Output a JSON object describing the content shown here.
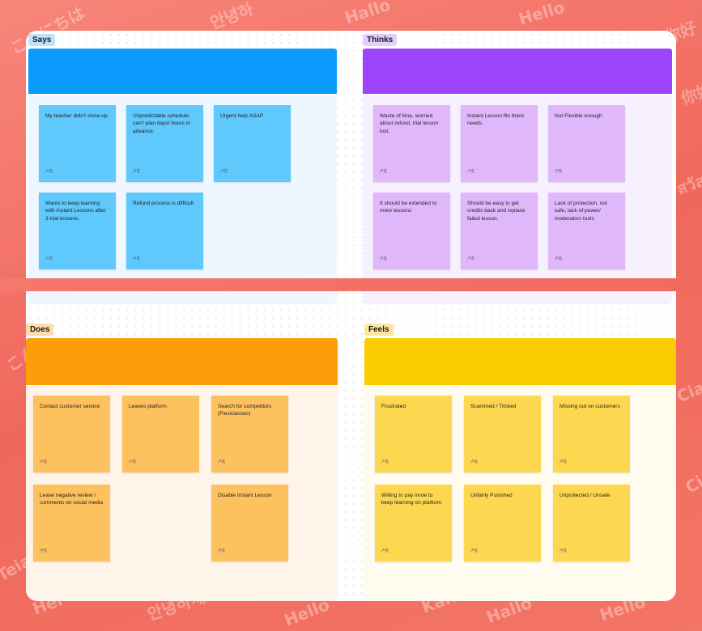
{
  "watermarks": [
    "こんにちは",
    "안녕하",
    "Hallo",
    "Hello",
    "你好",
    "Ciao",
    "안녕하세요",
    "Hello",
    "Hallo",
    "Hello",
    "Kan",
    "Teia",
    "Hei",
    "สวัสดี",
    "你好",
    "Ciao",
    "こんにちは",
    "안녕하세요",
    "Hello",
    "にちは"
  ],
  "quadrants": {
    "says": {
      "label": "Says",
      "banner_color": "#0a9bfd",
      "panel_color": "#eef7ff",
      "tag_color": "#bde3fd",
      "note_color": "#5fc8fc",
      "notes": [
        {
          "text": "My teacher didn't show up.",
          "author": "卢克"
        },
        {
          "text": "Unpredictable schedule, can't plan days/ hours in advance.",
          "author": "卢克"
        },
        {
          "text": "Urgent help ASAP",
          "author": "卢克"
        },
        {
          "text": "Wants to keep learning with Instant Lessons after 3 trial lessons.",
          "author": "卢克"
        },
        {
          "text": "Refund process is difficult",
          "author": "卢克"
        }
      ]
    },
    "thinks": {
      "label": "Thinks",
      "banner_color": "#9c44fc",
      "panel_color": "#f6f0ff",
      "tag_color": "#e2cdfc",
      "note_color": "#e0b7fb",
      "notes": [
        {
          "text": "Waste of time, worried about refund, trial lesson lost.",
          "author": "卢克"
        },
        {
          "text": "Instant Lesson fits there needs.",
          "author": "卢克"
        },
        {
          "text": "Not Flexible enough",
          "author": "卢克"
        },
        {
          "text": "It should be extended to more lessons",
          "author": "卢克"
        },
        {
          "text": "Should be easy to get credits back and replace failed lesson.",
          "author": "卢克"
        },
        {
          "text": "Lack of protection, not safe, lack of power/ moderation tools",
          "author": "卢克"
        }
      ]
    },
    "does": {
      "label": "Does",
      "banner_color": "#fd9d09",
      "panel_color": "#fff4ea",
      "tag_color": "#fddcae",
      "note_color": "#fdc15d",
      "notes": [
        {
          "text": "Contact customer service",
          "author": "卢克"
        },
        {
          "text": "Leaves platform",
          "author": "卢克"
        },
        {
          "text": "Search for competitors (Flexiclasses)",
          "author": "卢克"
        },
        {
          "text": "Leave negative review / comments on social media",
          "author": "卢克"
        },
        {
          "text": "Disable Instant Lesson",
          "author": "卢克"
        }
      ]
    },
    "feels": {
      "label": "Feels",
      "banner_color": "#fccc02",
      "panel_color": "#fffbee",
      "tag_color": "#fde6a0",
      "note_color": "#fdd74f",
      "notes": [
        {
          "text": "Frustrated",
          "author": "卢克"
        },
        {
          "text": "Scammed / Tricked",
          "author": "卢克"
        },
        {
          "text": "Missing out on customers",
          "author": "卢克"
        },
        {
          "text": "Willing to pay mroe to keep learning on platform",
          "author": "卢克"
        },
        {
          "text": "Unfairly Punished",
          "author": "卢克"
        },
        {
          "text": "Unprotected / Unsafe",
          "author": "卢克"
        }
      ]
    }
  }
}
